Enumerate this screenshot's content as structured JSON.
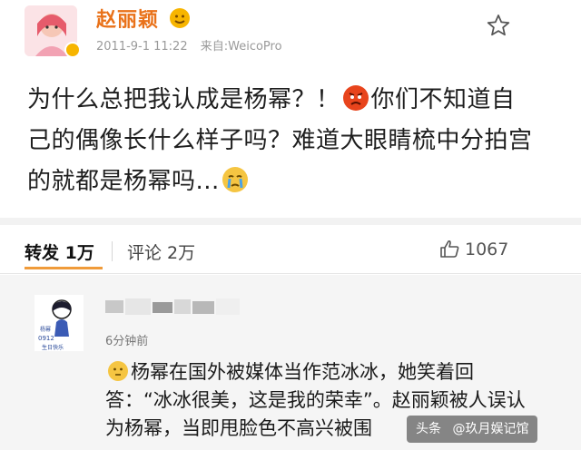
{
  "post": {
    "username": "赵丽颖",
    "timestamp": "2011-9-1 11:22",
    "source": "来自:WeicoPro",
    "text_parts": [
      "为什么总把我认成是杨幂？！",
      "你们不知道自己的偶像长什么样子吗？难道大眼睛梳中分拍宫的就都是杨幂吗...",
      ""
    ],
    "emoji_1": "angry-face-icon",
    "emoji_2": "crying-face-icon"
  },
  "actions": {
    "repost_label": "转发 1万",
    "comment_label": "评论 2万",
    "like_label": "1067"
  },
  "comment": {
    "time": "6分钟前",
    "text_1": "杨幂在国外被媒体当作范冰冰，她笑着回答：“冰冰很美，这是我的荣幸”。赵丽颖被人误认为杨幂，当即甩脸色不高兴被围",
    "emoji": "thinking-face-icon"
  },
  "watermark": {
    "platform": "头条",
    "account": "@玖月娱记馆"
  },
  "colors": {
    "username": "#e9721a",
    "tab_underline": "#f09b3a"
  }
}
